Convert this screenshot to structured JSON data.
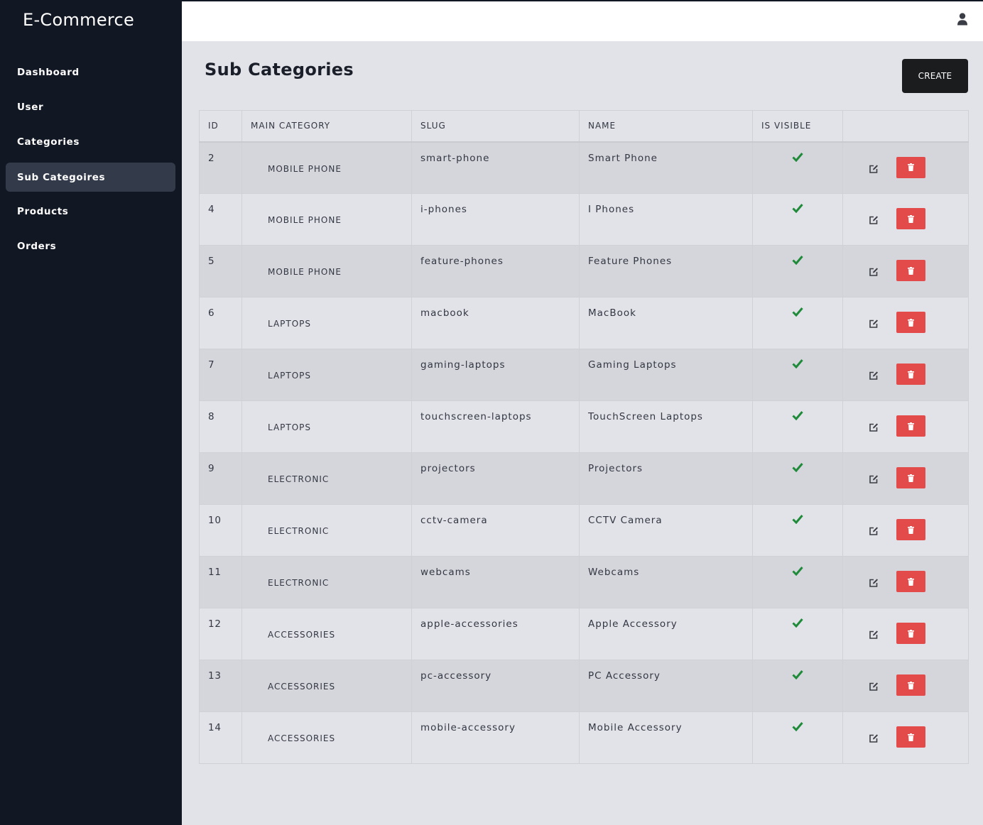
{
  "app": {
    "title": "E-Commerce"
  },
  "sidebar": {
    "items": [
      {
        "label": "Dashboard",
        "active": false
      },
      {
        "label": "User",
        "active": false
      },
      {
        "label": "Categories",
        "active": false
      },
      {
        "label": "Sub Categoires",
        "active": true
      },
      {
        "label": "Products",
        "active": false
      },
      {
        "label": "Orders",
        "active": false
      }
    ]
  },
  "header": {
    "user_icon": "user-icon"
  },
  "main": {
    "title": "Sub Categories",
    "create_label": "CREATE",
    "table": {
      "columns": [
        "ID",
        "MAIN CATEGORY",
        "SLUG",
        "NAME",
        "IS VISIBLE",
        ""
      ],
      "rows": [
        {
          "id": "2",
          "main_category": "MOBILE PHONE",
          "slug": "smart-phone",
          "name": "Smart Phone",
          "visible": true
        },
        {
          "id": "4",
          "main_category": "MOBILE PHONE",
          "slug": "i-phones",
          "name": "I Phones",
          "visible": true
        },
        {
          "id": "5",
          "main_category": "MOBILE PHONE",
          "slug": "feature-phones",
          "name": "Feature Phones",
          "visible": true
        },
        {
          "id": "6",
          "main_category": "LAPTOPS",
          "slug": "macbook",
          "name": "MacBook",
          "visible": true
        },
        {
          "id": "7",
          "main_category": "LAPTOPS",
          "slug": "gaming-laptops",
          "name": "Gaming Laptops",
          "visible": true
        },
        {
          "id": "8",
          "main_category": "LAPTOPS",
          "slug": "touchscreen-laptops",
          "name": "TouchScreen Laptops",
          "visible": true
        },
        {
          "id": "9",
          "main_category": "ELECTRONIC",
          "slug": "projectors",
          "name": "Projectors",
          "visible": true
        },
        {
          "id": "10",
          "main_category": "ELECTRONIC",
          "slug": "cctv-camera",
          "name": "CCTV Camera",
          "visible": true
        },
        {
          "id": "11",
          "main_category": "ELECTRONIC",
          "slug": "webcams",
          "name": "Webcams",
          "visible": true
        },
        {
          "id": "12",
          "main_category": "ACCESSORIES",
          "slug": "apple-accessories",
          "name": "Apple Accessory",
          "visible": true
        },
        {
          "id": "13",
          "main_category": "ACCESSORIES",
          "slug": "pc-accessory",
          "name": "PC Accessory",
          "visible": true
        },
        {
          "id": "14",
          "main_category": "ACCESSORIES",
          "slug": "mobile-accessory",
          "name": "Mobile Accessory",
          "visible": true
        }
      ]
    }
  },
  "colors": {
    "sidebar_bg": "#111723",
    "sidebar_active": "#333b4b",
    "content_bg": "#e2e3e8",
    "row_alt": "#d5d6db",
    "check": "#1e8a3a",
    "delete": "#e24b4a",
    "create_bg": "#1b1c1e"
  }
}
